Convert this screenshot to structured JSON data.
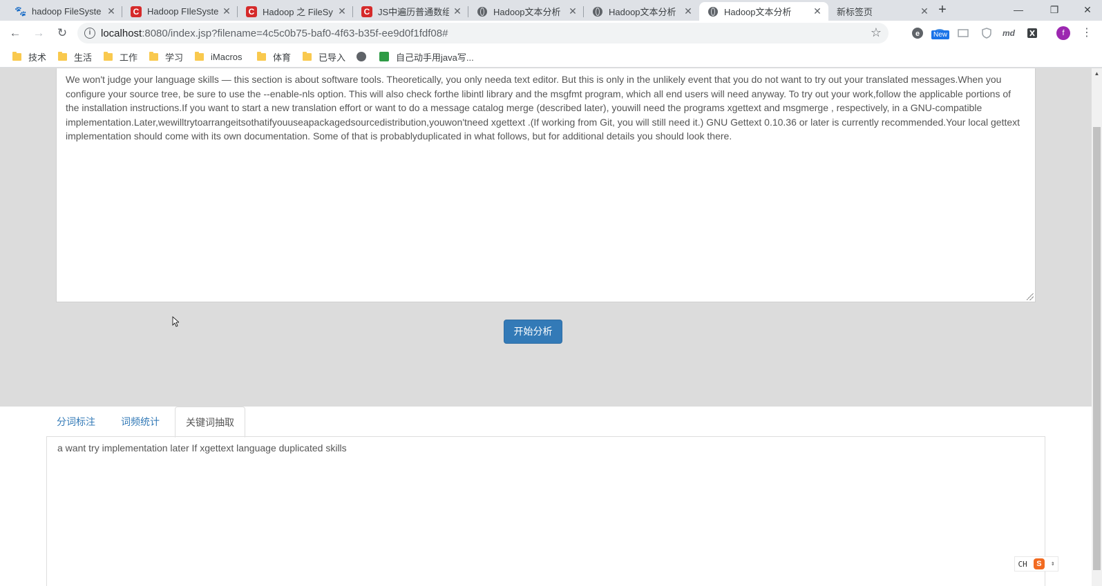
{
  "browser": {
    "tabs": [
      {
        "title": "hadoop FileSyste",
        "favicon": "baidu-icon"
      },
      {
        "title": "Hadoop FIleSyste",
        "favicon": "csdn-icon"
      },
      {
        "title": "Hadoop 之 FileSy",
        "favicon": "csdn-icon"
      },
      {
        "title": "JS中遍历普通数组",
        "favicon": "csdn-icon"
      },
      {
        "title": "Hadoop文本分析",
        "favicon": "globe-icon"
      },
      {
        "title": "Hadoop文本分析",
        "favicon": "globe-icon"
      },
      {
        "title": "Hadoop文本分析",
        "favicon": "globe-icon",
        "active": true
      },
      {
        "title": "新标签页",
        "favicon": ""
      }
    ],
    "url_host": "localhost",
    "url_rest": ":8080/index.jsp?filename=4c5c0b75-baf0-4f63-b35f-ee9d0f1fdf08#",
    "ext_new_badge": "New",
    "ext_md": "md",
    "avatar_letter": "f",
    "bookmarks": [
      {
        "label": "技术",
        "type": "folder"
      },
      {
        "label": "生活",
        "type": "folder"
      },
      {
        "label": "工作",
        "type": "folder"
      },
      {
        "label": "学习",
        "type": "folder"
      },
      {
        "label": "iMacros",
        "type": "folder"
      },
      {
        "label": "体育",
        "type": "folder"
      },
      {
        "label": "已导入",
        "type": "folder"
      },
      {
        "label": "",
        "type": "globe"
      },
      {
        "label": "自己动手用java写...",
        "type": "page"
      }
    ]
  },
  "page": {
    "source_text": "We won't judge your language skills — this section is about software tools. Theoretically, you only needa text editor. But this is only in the unlikely event that you do not want to try out your translated messages.When you configure your source tree, be sure to use the --enable-nls option. This will also check forthe libintl library and the msgfmt program, which all end users will need anyway. To try out your work,follow the applicable portions of the installation instructions.If you want to start a new translation effort or want to do a message catalog merge (described later), youwill need the programs xgettext and msgmerge , respectively, in a GNU-compatible implementation.Later,wewilltrytoarrangeitsothatifyouuseapackagedsourcedistribution,youwon'tneed xgettext .(If working from Git, you will still need it.) GNU Gettext 0.10.36 or later is currently recommended.Your local gettext implementation should come with its own documentation. Some of that is probablyduplicated in what follows, but for additional details you should look there.",
    "analyze_button": "开始分析",
    "result_tabs": [
      {
        "label": "分词标注"
      },
      {
        "label": "词频统计"
      },
      {
        "label": "关键词抽取",
        "active": true
      }
    ],
    "result_text": "a want try implementation later If xgettext language duplicated skills",
    "ime_label": "CH",
    "ime_logo": "S"
  },
  "colors": {
    "primary_button": "#337ab7",
    "tab_link": "#337ab7",
    "page_bg": "#dcdcdc"
  }
}
